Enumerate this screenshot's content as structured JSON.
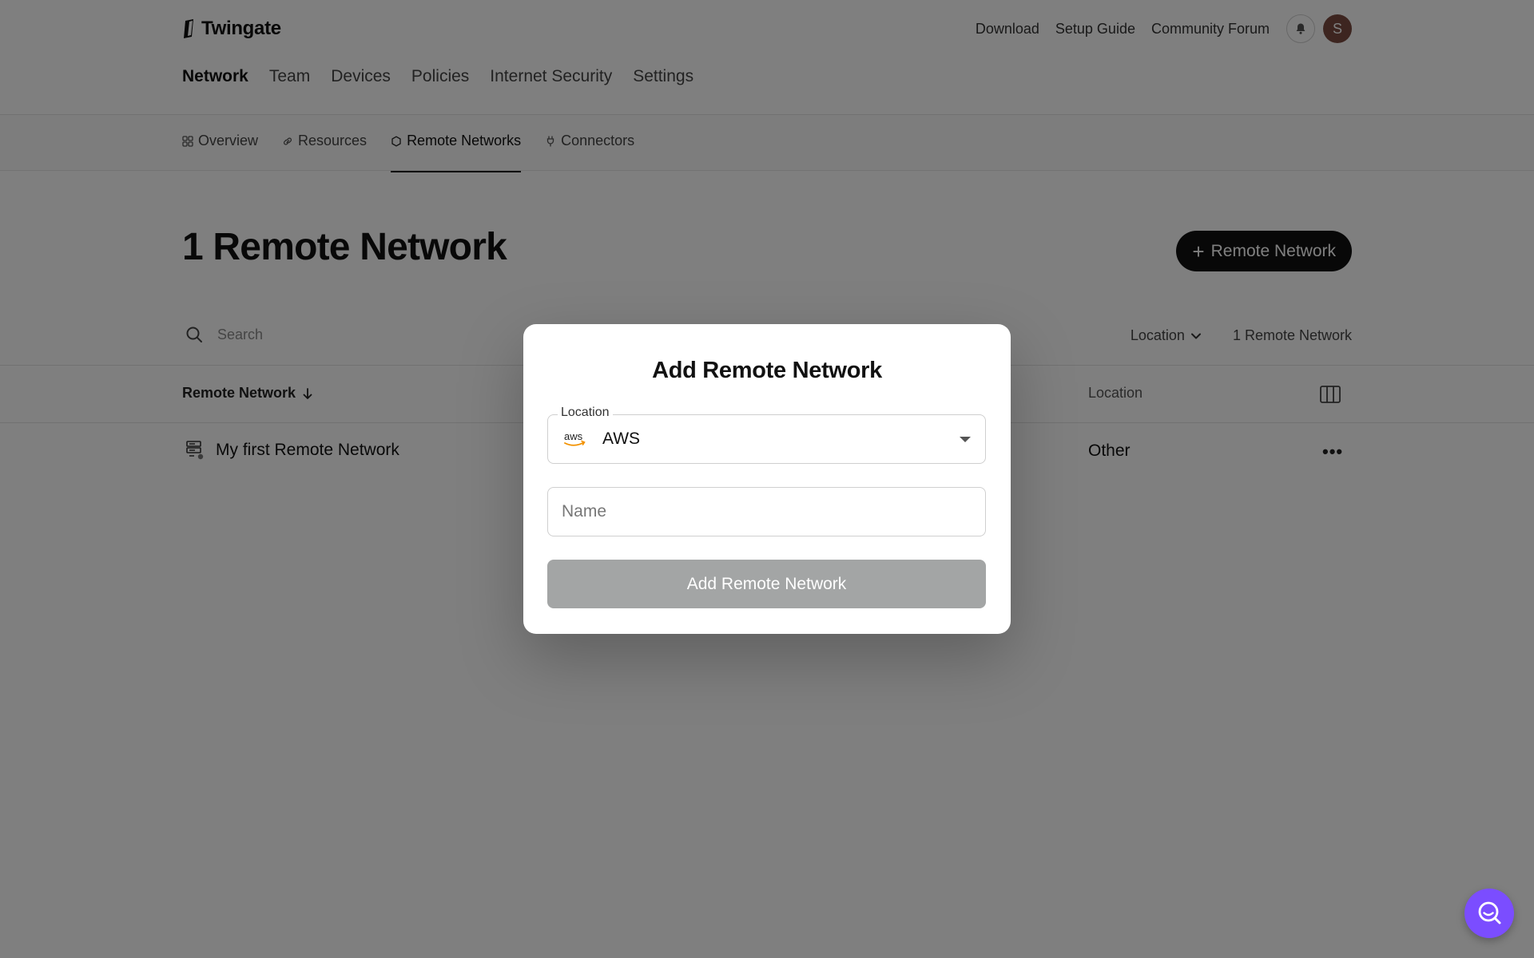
{
  "brand": {
    "name": "Twingate"
  },
  "header": {
    "links": [
      "Download",
      "Setup Guide",
      "Community Forum"
    ],
    "avatar_initial": "S"
  },
  "main_nav": {
    "items": [
      "Network",
      "Team",
      "Devices",
      "Policies",
      "Internet Security",
      "Settings"
    ],
    "active": "Network"
  },
  "sub_nav": {
    "tabs": [
      {
        "label": "Overview",
        "icon": "grid-icon"
      },
      {
        "label": "Resources",
        "icon": "link-icon"
      },
      {
        "label": "Remote Networks",
        "icon": "hexagon-icon"
      },
      {
        "label": "Connectors",
        "icon": "plug-icon"
      }
    ],
    "active": "Remote Networks"
  },
  "page": {
    "title": "1 Remote Network",
    "add_button": "Remote Network",
    "search_placeholder": "Search",
    "location_filter": "Location",
    "count_label": "1 Remote Network"
  },
  "table": {
    "columns": [
      "Remote Network",
      "Location"
    ],
    "rows": [
      {
        "name": "My first Remote Network",
        "location": "Other"
      }
    ]
  },
  "modal": {
    "title": "Add Remote Network",
    "location_label": "Location",
    "location_logo_text": "aws",
    "location_value": "AWS",
    "name_placeholder": "Name",
    "submit_label": "Add Remote Network"
  },
  "colors": {
    "overlay": "#000000",
    "accent_help": "#7b4dff",
    "avatar": "#7a4b40",
    "primary_button": "#111111",
    "disabled_button": "#a3a5a5"
  }
}
